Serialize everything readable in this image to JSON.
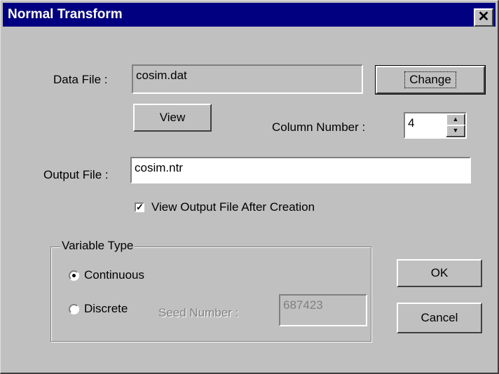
{
  "window": {
    "title": "Normal Transform",
    "close_glyph": "✕"
  },
  "data_file": {
    "label": "Data File :",
    "value": "cosim.dat",
    "change_label": "Change",
    "view_label": "View"
  },
  "column": {
    "label": "Column Number :",
    "value": "4",
    "up_icon": "▲",
    "down_icon": "▼"
  },
  "output_file": {
    "label": "Output File :",
    "value": "cosim.ntr"
  },
  "view_after": {
    "label": "View Output File After Creation",
    "checked_glyph": "✓"
  },
  "variable_type": {
    "legend": "Variable Type",
    "continuous_label": "Continuous",
    "discrete_label": "Discrete",
    "seed_label": "Seed Number :",
    "seed_value": "687423"
  },
  "actions": {
    "ok_label": "OK",
    "cancel_label": "Cancel"
  }
}
